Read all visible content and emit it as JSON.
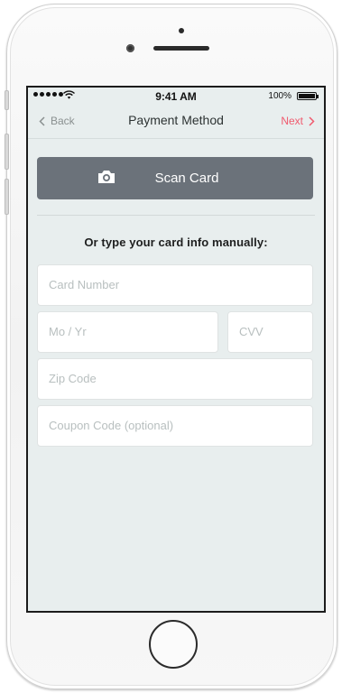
{
  "status_bar": {
    "time": "9:41 AM",
    "battery_pct": "100%"
  },
  "nav": {
    "back_label": "Back",
    "title": "Payment Method",
    "next_label": "Next",
    "next_color": "#f05a6e"
  },
  "scan_button": {
    "label": "Scan Card",
    "icon": "camera-icon",
    "color": "#6b727a"
  },
  "manual_label": "Or type your card info manually:",
  "fields": {
    "card_number": {
      "placeholder": "Card Number",
      "value": ""
    },
    "month_year": {
      "placeholder": "Mo / Yr",
      "value": ""
    },
    "cvv": {
      "placeholder": "CVV",
      "value": ""
    },
    "zip": {
      "placeholder": "Zip Code",
      "value": ""
    },
    "coupon": {
      "placeholder": "Coupon Code (optional)",
      "value": ""
    }
  }
}
